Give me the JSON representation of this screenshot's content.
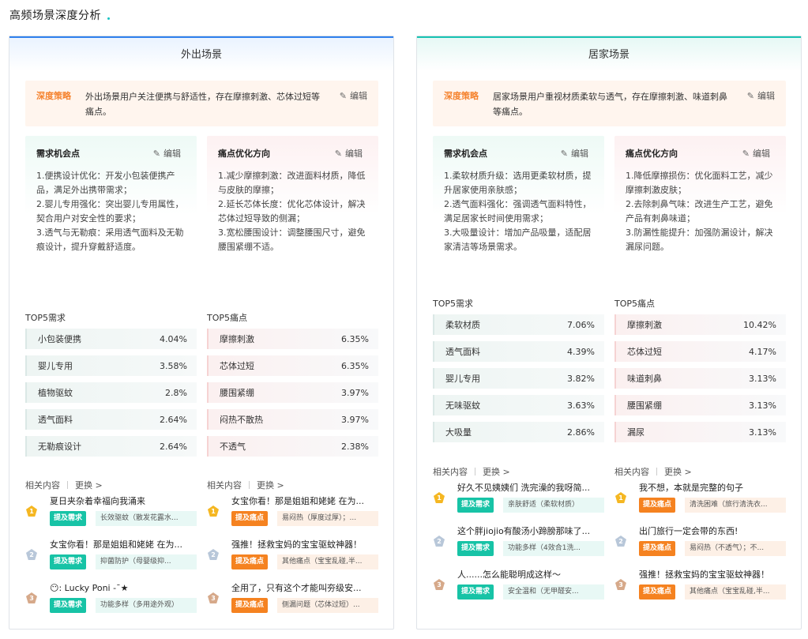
{
  "page_title": "高频场景深度分析",
  "edit_label": "编辑",
  "scenes": [
    {
      "title": "外出场景",
      "strategy_label": "深度策略",
      "strategy_text": "外出场景用户关注便携与舒适性，存在摩擦刺激、芯体过短等痛点。",
      "need_title": "需求机会点",
      "need_body": "1.便携设计优化：开发小包装便携产品，满足外出携带需求；\n 2.婴儿专用强化：突出婴儿专用属性，契合用户对安全性的要求；\n 3.透气与无勒痕：采用透气面料及无勒痕设计，提升穿戴舒适度。",
      "pain_title": "痛点优化方向",
      "pain_body": "1.减少摩擦刺激：改进面料材质，降低与皮肤的摩擦；\n 2.延长芯体长度：优化芯体设计，解决芯体过短导致的侧漏；\n 3.宽松腰围设计：调整腰围尺寸，避免腰围紧绷不适。",
      "top_need_label": "TOP5需求",
      "top_pain_label": "TOP5痛点",
      "top_needs": [
        {
          "name": "小包装便携",
          "pct": "4.04%"
        },
        {
          "name": "婴儿专用",
          "pct": "3.58%"
        },
        {
          "name": "植物驱蚊",
          "pct": "2.8%"
        },
        {
          "name": "透气面料",
          "pct": "2.64%"
        },
        {
          "name": "无勒痕设计",
          "pct": "2.64%"
        }
      ],
      "top_pains": [
        {
          "name": "摩擦刺激",
          "pct": "6.35%"
        },
        {
          "name": "芯体过短",
          "pct": "6.35%"
        },
        {
          "name": "腰围紧绷",
          "pct": "3.97%"
        },
        {
          "name": "闷热不散热",
          "pct": "3.97%"
        },
        {
          "name": "不透气",
          "pct": "2.38%"
        }
      ],
      "related_label": "相关内容",
      "refresh_label": "更换 >",
      "need_items": [
        {
          "rank": "1",
          "title": "夏日夹杂着幸福向我涌来",
          "tag": "提及需求",
          "desc": "长效驱蚊（散发花露水..."
        },
        {
          "rank": "2",
          "title": "女宝你看！那是姐姐和姥姥 在为...",
          "tag": "提及需求",
          "desc": "抑菌防护（母婴级抑..."
        },
        {
          "rank": "3",
          "title": "😶: Lucky Poni -ˉ★",
          "tag": "提及需求",
          "desc": "功能多样（多用途外观）"
        }
      ],
      "pain_items": [
        {
          "rank": "1",
          "title": "女宝你看！那是姐姐和姥姥 在为...",
          "tag": "提及痛点",
          "desc": "易闷热（厚度过厚）；..."
        },
        {
          "rank": "2",
          "title": "强推！拯救宝妈的宝宝驱蚊神器！",
          "tag": "提及痛点",
          "desc": "其他痛点（宝宝乱碰,半..."
        },
        {
          "rank": "3",
          "title": "全用了，只有这个才能叫夯级安...",
          "tag": "提及痛点",
          "desc": "侧漏问题（芯体过短）..."
        }
      ]
    },
    {
      "title": "居家场景",
      "strategy_label": "深度策略",
      "strategy_text": "居家场景用户重视材质柔软与透气，存在摩擦刺激、味道刺鼻等痛点。",
      "need_title": "需求机会点",
      "need_body": "1.柔软材质升级：选用更柔软材质，提升居家使用亲肤感；\n 2.透气面料强化：强调透气面料特性，满足居家长时间使用需求；\n 3.大吸量设计：增加产品吸量，适配居家清洁等场景需求。",
      "pain_title": "痛点优化方向",
      "pain_body": "1.降低摩擦损伤：优化面料工艺，减少摩擦刺激皮肤；\n 2.去除刺鼻气味：改进生产工艺，避免产品有刺鼻味道；\n 3.防漏性能提升：加强防漏设计，解决漏尿问题。",
      "top_need_label": "TOP5需求",
      "top_pain_label": "TOP5痛点",
      "top_needs": [
        {
          "name": "柔软材质",
          "pct": "7.06%"
        },
        {
          "name": "透气面料",
          "pct": "4.39%"
        },
        {
          "name": "婴儿专用",
          "pct": "3.82%"
        },
        {
          "name": "无味驱蚊",
          "pct": "3.63%"
        },
        {
          "name": "大吸量",
          "pct": "2.86%"
        }
      ],
      "top_pains": [
        {
          "name": "摩擦刺激",
          "pct": "10.42%"
        },
        {
          "name": "芯体过短",
          "pct": "4.17%"
        },
        {
          "name": "味道刺鼻",
          "pct": "3.13%"
        },
        {
          "name": "腰围紧绷",
          "pct": "3.13%"
        },
        {
          "name": "漏尿",
          "pct": "3.13%"
        }
      ],
      "related_label": "相关内容",
      "refresh_label": "更换 >",
      "need_items": [
        {
          "rank": "1",
          "title": "好久不见姨姨们 洗完澡的我呀简...",
          "tag": "提及需求",
          "desc": "亲肤舒适（柔软材质）"
        },
        {
          "rank": "2",
          "title": "这个胖jiojio有酸汤小蹄膀那味了...",
          "tag": "提及需求",
          "desc": "功能多样（4效合1洗..."
        },
        {
          "rank": "3",
          "title": "人......怎么能聪明成这样～",
          "tag": "提及需求",
          "desc": "安全温和（无甲醛安..."
        }
      ],
      "pain_items": [
        {
          "rank": "1",
          "title": "我不想，本就是完整的句子",
          "tag": "提及痛点",
          "desc": "清洗困难（旅行清洗衣..."
        },
        {
          "rank": "2",
          "title": "出门旅行一定会带的东西!",
          "tag": "提及痛点",
          "desc": "易闷热（不透气）；不..."
        },
        {
          "rank": "3",
          "title": "强推！拯救宝妈的宝宝驱蚊神器！",
          "tag": "提及痛点",
          "desc": "其他痛点（宝宝乱碰,半..."
        }
      ]
    }
  ]
}
